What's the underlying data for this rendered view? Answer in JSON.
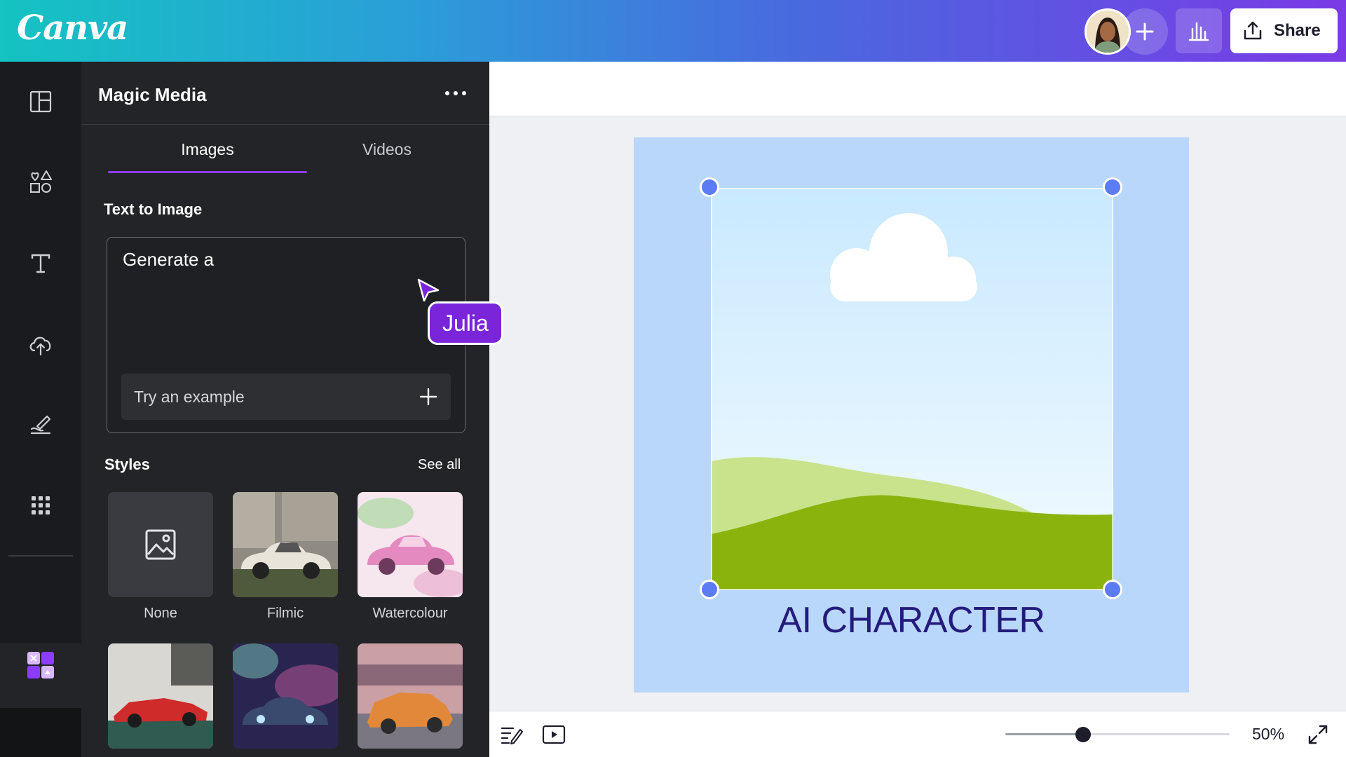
{
  "app": {
    "logo": "Canva"
  },
  "header": {
    "share_label": "Share"
  },
  "rail": {
    "items": [
      {
        "icon": "layout-icon",
        "label": "Design"
      },
      {
        "icon": "elements-icon",
        "label": "Elements"
      },
      {
        "icon": "text-icon",
        "label": "Text"
      },
      {
        "icon": "upload-icon",
        "label": "Uploads"
      },
      {
        "icon": "draw-icon",
        "label": "Draw"
      },
      {
        "icon": "apps-icon",
        "label": "Apps"
      },
      {
        "icon": "magic-media-icon",
        "label": "Magic Media"
      }
    ]
  },
  "panel": {
    "title": "Magic Media",
    "tabs": [
      {
        "label": "Images",
        "active": true
      },
      {
        "label": "Videos",
        "active": false
      }
    ],
    "text_to_image_label": "Text to Image",
    "prompt_value": "Generate a",
    "example_button": "Try an example",
    "styles_label": "Styles",
    "see_all": "See all",
    "styles": [
      {
        "label": "None"
      },
      {
        "label": "Filmic"
      },
      {
        "label": "Watercolour"
      },
      {
        "label": ""
      },
      {
        "label": ""
      },
      {
        "label": ""
      }
    ]
  },
  "collaborator": {
    "name": "Julia",
    "color": "#7a25d9"
  },
  "canvas": {
    "title_text": "AI CHARACTER",
    "background_color": "#b9d7fb",
    "selection_color": "#5b7cf5"
  },
  "footer": {
    "zoom_label": "50%",
    "zoom_percent": 50
  }
}
